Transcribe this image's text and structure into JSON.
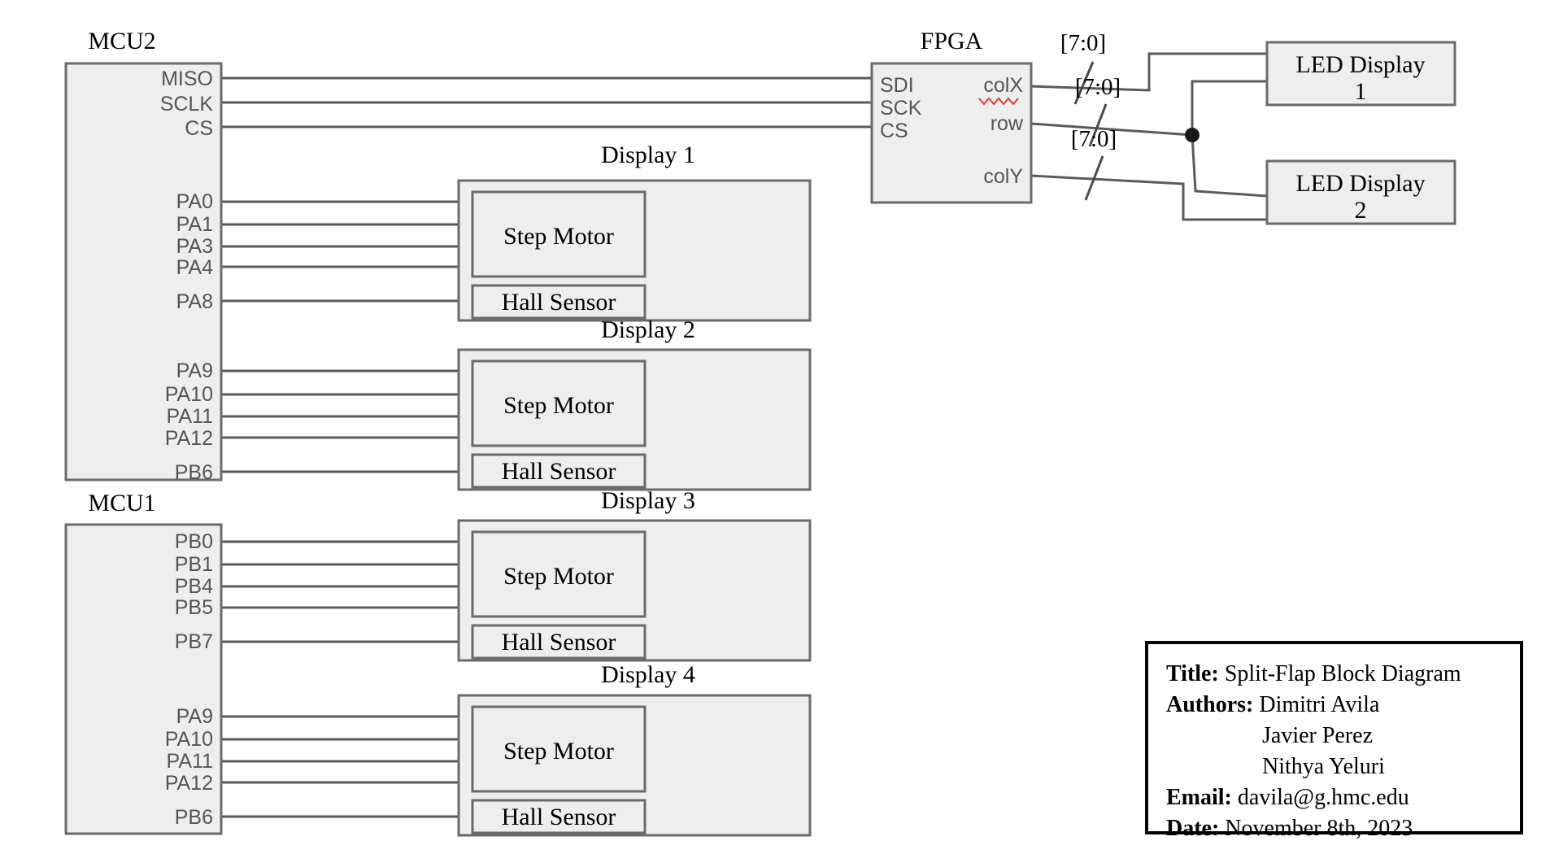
{
  "diagram": {
    "kind": "block-diagram",
    "colors": {
      "block_fill": "#eeeeee",
      "block_stroke": "#6b6b6b",
      "wire": "#5a5a5a",
      "text": "#000000",
      "pin_text": "#555555",
      "spellcheck_underline": "#e03a2f",
      "background": "#ffffff"
    }
  },
  "mcu2": {
    "title": "MCU2",
    "spi_pins": [
      "MISO",
      "SCLK",
      "CS"
    ],
    "display1_pins": [
      "PA0",
      "PA1",
      "PA3",
      "PA4"
    ],
    "display1_hall_pin": "PA8",
    "display2_pins": [
      "PA9",
      "PA10",
      "PA11",
      "PA12"
    ],
    "display2_hall_pin": "PB6"
  },
  "mcu1": {
    "title": "MCU1",
    "display3_pins": [
      "PB0",
      "PB1",
      "PB4",
      "PB5"
    ],
    "display3_hall_pin": "PB7",
    "display4_pins": [
      "PA9",
      "PA10",
      "PA11",
      "PA12"
    ],
    "display4_hall_pin": "PB6"
  },
  "fpga": {
    "title": "FPGA",
    "inputs": [
      "SDI",
      "SCK",
      "CS"
    ],
    "outputs": [
      "colX",
      "row",
      "colY"
    ],
    "spellcheck_flagged": "colX"
  },
  "buses": {
    "colX_width": "[7:0]",
    "row_width": "[7:0]",
    "colY_width": "[7:0]"
  },
  "led_displays": [
    {
      "line1": "LED Display",
      "line2": "1"
    },
    {
      "line1": "LED Display",
      "line2": "2"
    }
  ],
  "displays": [
    {
      "title": "Display 1",
      "motor": "Step Motor",
      "sensor": "Hall Sensor"
    },
    {
      "title": "Display 2",
      "motor": "Step Motor",
      "sensor": "Hall Sensor"
    },
    {
      "title": "Display 3",
      "motor": "Step Motor",
      "sensor": "Hall Sensor"
    },
    {
      "title": "Display 4",
      "motor": "Step Motor",
      "sensor": "Hall Sensor"
    }
  ],
  "title_block": {
    "title_key": "Title:",
    "title_value": "Split-Flap Block Diagram",
    "authors_key": "Authors:",
    "author1": "Dimitri Avila",
    "author2": "Javier Perez",
    "author3": "Nithya Yeluri",
    "email_key": "Email:",
    "email_value": "davila@g.hmc.edu",
    "date_key": "Date:",
    "date_value": "November 8th, 2023"
  }
}
